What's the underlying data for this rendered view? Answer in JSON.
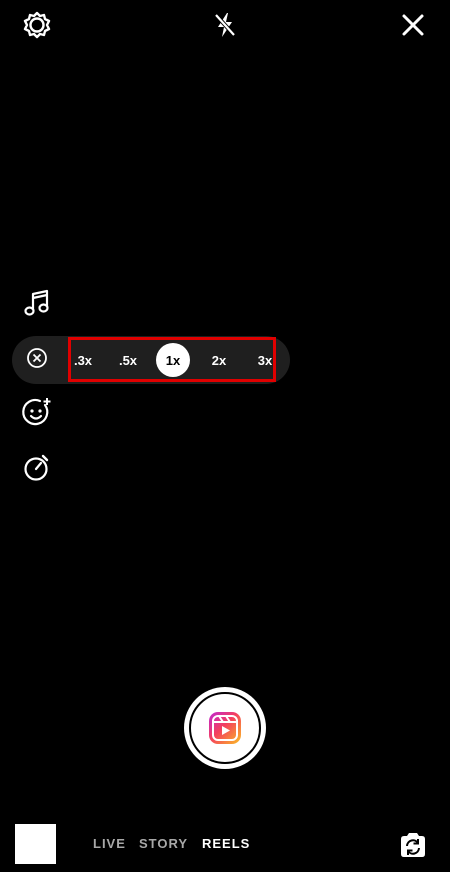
{
  "top_bar": {
    "settings_icon": "gear-icon",
    "flash_icon": "flash-off-icon",
    "close_icon": "close-icon"
  },
  "side_tools": [
    {
      "icon": "music-icon"
    },
    {
      "icon": "effects-face-icon"
    },
    {
      "icon": "timer-icon"
    }
  ],
  "speed_selector": {
    "close_icon": "close-circle-icon",
    "options": [
      ".3x",
      ".5x",
      "1x",
      "2x",
      "3x"
    ],
    "selected": "1x"
  },
  "shutter": {
    "icon": "reels-icon"
  },
  "bottom_bar": {
    "modes": [
      "LIVE",
      "STORY",
      "REELS"
    ],
    "active_mode": "REELS",
    "flip_camera_icon": "flip-camera-icon"
  },
  "colors": {
    "background": "#000000",
    "highlight_box": "#e00000",
    "pill": "#1f1f1f",
    "inactive_mode": "#a8a8a8"
  }
}
